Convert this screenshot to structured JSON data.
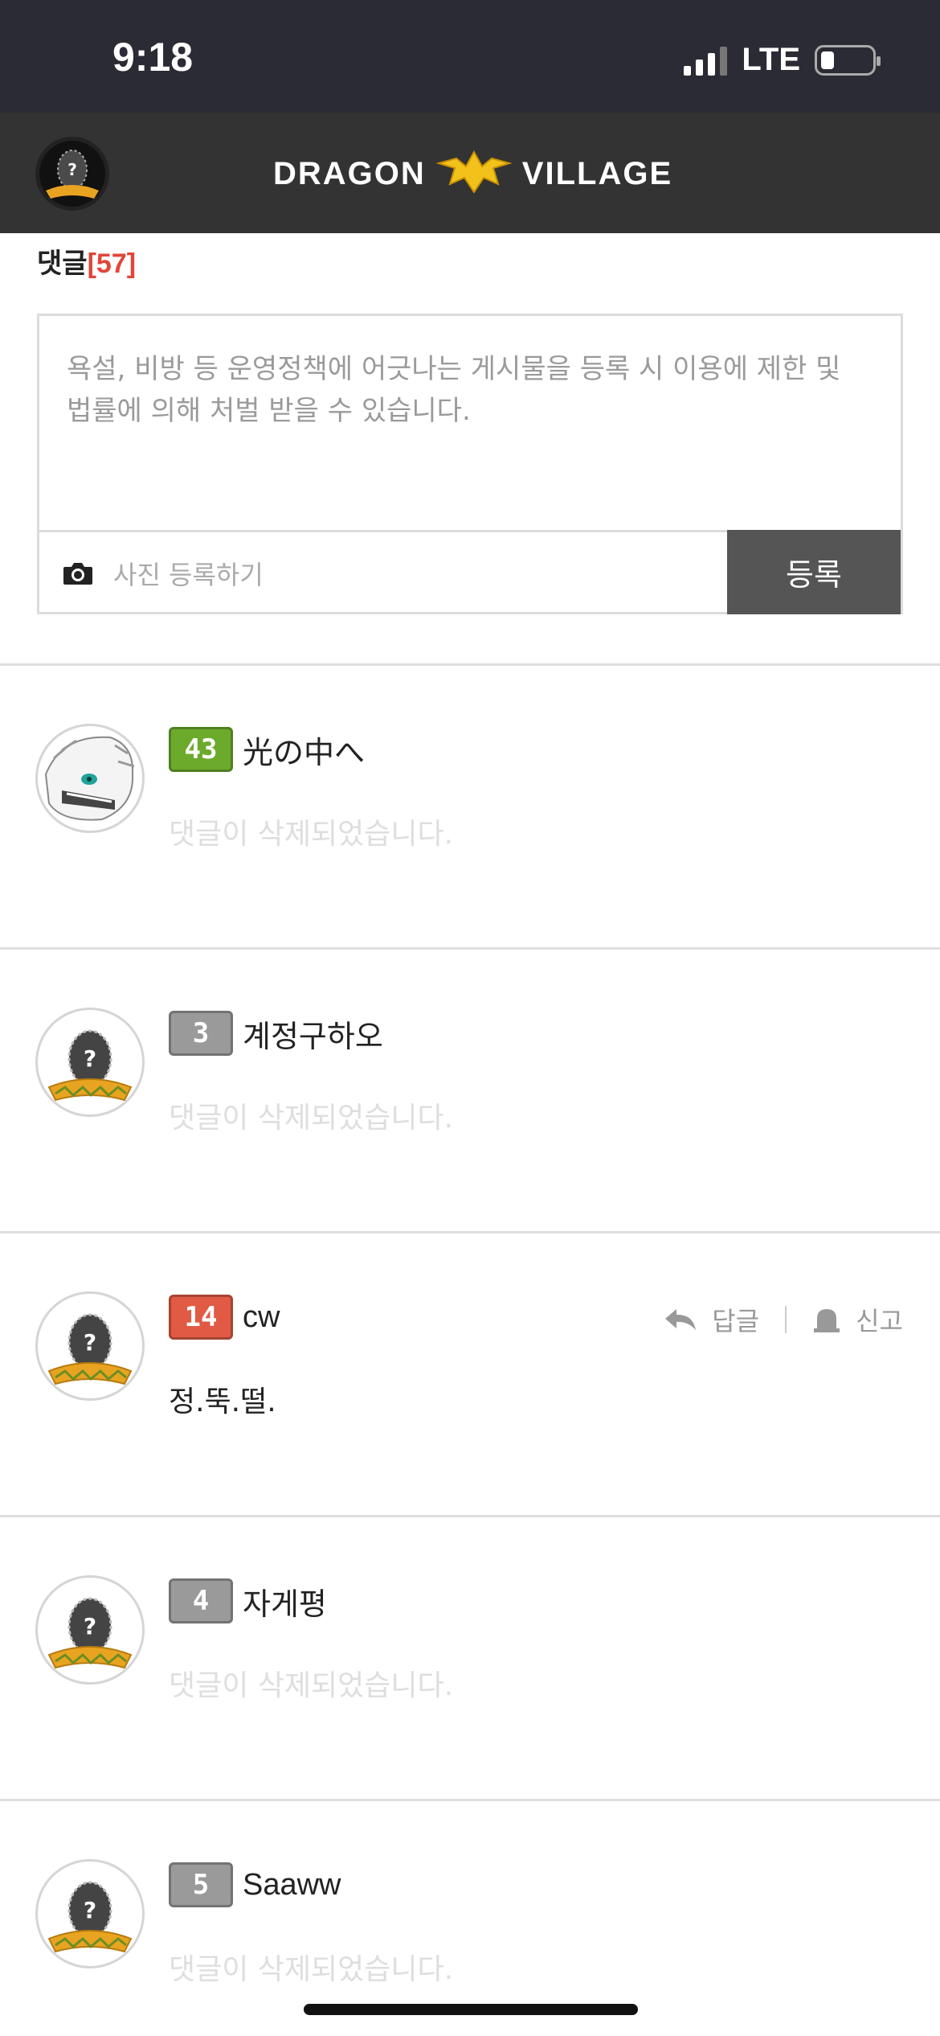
{
  "status_bar": {
    "time": "9:18",
    "network": "LTE"
  },
  "header": {
    "logo_left": "DRAGON",
    "logo_right": "VILLAGE"
  },
  "comments_section": {
    "label": "댓글",
    "count": "[57]",
    "composer": {
      "placeholder": "욕설, 비방 등 운영정책에 어긋나는 게시물을 등록 시 이용에 제한 및 법률에 의해 처벌 받을 수 있습니다.",
      "photo_label": "사진 등록하기",
      "submit_label": "등록"
    }
  },
  "comments": [
    {
      "level": "43",
      "level_color": "#6caa2c",
      "username": "光の中へ",
      "body": "댓글이 삭제되었습니다.",
      "deleted": true,
      "avatar": "white-dragon-avatar"
    },
    {
      "level": "3",
      "level_color": "#9a9a9a",
      "username": "계정구하오",
      "body": "댓글이 삭제되었습니다.",
      "deleted": true,
      "avatar": "egg-avatar"
    },
    {
      "level": "14",
      "level_color": "#e05a44",
      "username": "cw",
      "body": "정.뚝.떨.",
      "deleted": false,
      "avatar": "egg-avatar",
      "reply_label": "답글",
      "report_label": "신고"
    },
    {
      "level": "4",
      "level_color": "#9a9a9a",
      "username": "자게평",
      "body": "댓글이 삭제되었습니다.",
      "deleted": true,
      "avatar": "egg-avatar"
    },
    {
      "level": "5",
      "level_color": "#9a9a9a",
      "username": "Saaww",
      "body": "댓글이 삭제되었습니다.",
      "deleted": true,
      "avatar": "egg-avatar"
    }
  ],
  "colors": {
    "accent_red": "#e2463a",
    "header_bg": "#333333",
    "status_bg": "#2b2b35",
    "submit_bg": "#555555"
  }
}
